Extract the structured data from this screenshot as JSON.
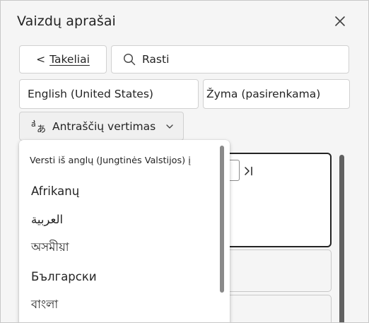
{
  "pane": {
    "title": "Vaizdų aprašai",
    "close_icon": "close-icon"
  },
  "toolbar": {
    "back_arrow": "<",
    "back_label": "Takeliai",
    "search_icon": "search-icon",
    "search_placeholder": "Rasti"
  },
  "fields": {
    "language": "English (United States)",
    "tag_placeholder": "Žyma (pasirenkama)"
  },
  "translate": {
    "icon": "translate-icon",
    "label": "Antraščių vertimas",
    "chevron_icon": "chevron-down-icon"
  },
  "menu": {
    "header": "Versti iš anglų (Jungtinės Valstijos) į",
    "items": [
      {
        "label": "Afrikanų"
      },
      {
        "label": "العربية"
      },
      {
        "label": "অসমীয়া"
      },
      {
        "label": "Български"
      },
      {
        "label": "বাংলা"
      }
    ]
  },
  "colors": {
    "pane_bg": "#f5f5f5",
    "text": "#242424",
    "border": "#d1d1d1"
  }
}
